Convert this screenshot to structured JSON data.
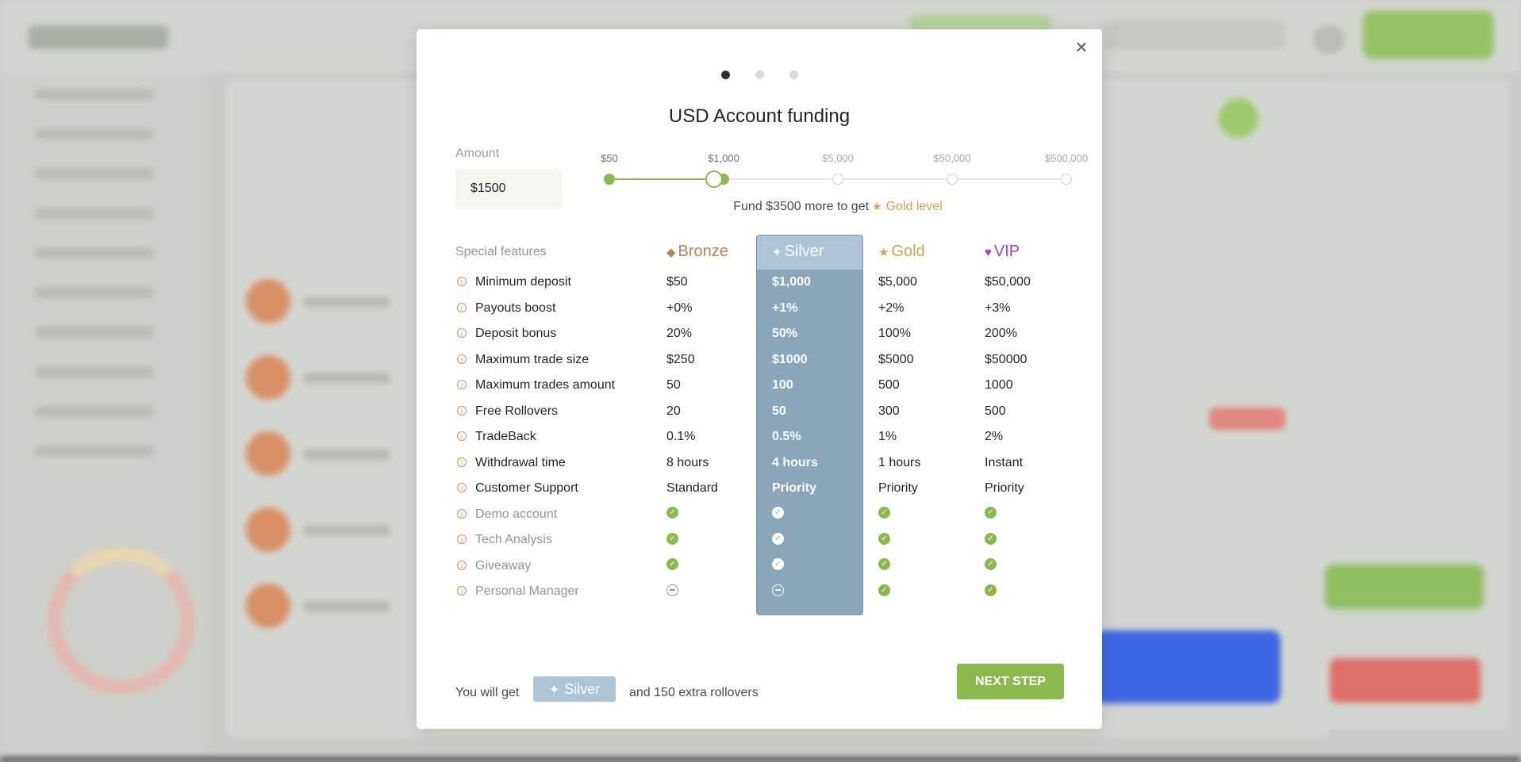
{
  "modal": {
    "title": "USD Account funding",
    "close_symbol": "×",
    "steps": 3,
    "amount_label": "Amount",
    "amount_value": "$1500",
    "slider": {
      "ticks": [
        "$50",
        "$1,000",
        "$5,000",
        "$50,000",
        "$500,000"
      ],
      "reached_count": 2,
      "position": 0.23
    },
    "fund_note": {
      "text": "Fund $3500 more to get",
      "level": "Gold level"
    },
    "table": {
      "feature_header": "Special features",
      "columns": [
        {
          "name": "Bronze",
          "icon": "diamond-icon",
          "glyph": "◆",
          "color": "#c07f58"
        },
        {
          "name": "Silver",
          "icon": "sparkle-icon",
          "glyph": "✦",
          "color": "#ffffff"
        },
        {
          "name": "Gold",
          "icon": "star-icon",
          "glyph": "★",
          "color": "#d0a352"
        },
        {
          "name": "VIP",
          "icon": "heart-icon",
          "glyph": "♥",
          "color": "#a13ed6"
        }
      ],
      "highlighted_column": 1,
      "rows": [
        {
          "feature": "Minimum deposit",
          "values": [
            "$50",
            "$1,000",
            "$5,000",
            "$50,000"
          ]
        },
        {
          "feature": "Payouts boost",
          "values": [
            "+0%",
            "+1%",
            "+2%",
            "+3%"
          ]
        },
        {
          "feature": "Deposit bonus",
          "values": [
            "20%",
            "50%",
            "100%",
            "200%"
          ]
        },
        {
          "feature": "Maximum trade size",
          "values": [
            "$250",
            "$1000",
            "$5000",
            "$50000"
          ]
        },
        {
          "feature": "Maximum trades amount",
          "values": [
            "50",
            "100",
            "500",
            "1000"
          ]
        },
        {
          "feature": "Free Rollovers",
          "values": [
            "20",
            "50",
            "300",
            "500"
          ]
        },
        {
          "feature": "TradeBack",
          "values": [
            "0.1%",
            "0.5%",
            "1%",
            "2%"
          ]
        },
        {
          "feature": "Withdrawal time",
          "values": [
            "8 hours",
            "4 hours",
            "1 hours",
            "Instant"
          ]
        },
        {
          "feature": "Customer Support",
          "values": [
            "Standard",
            "Priority",
            "Priority",
            "Priority"
          ]
        },
        {
          "feature": "Demo account",
          "muted": true,
          "flags": [
            true,
            true,
            true,
            true
          ]
        },
        {
          "feature": "Tech Analysis",
          "muted": true,
          "flags": [
            true,
            true,
            true,
            true
          ]
        },
        {
          "feature": "Giveaway",
          "muted": true,
          "flags": [
            true,
            true,
            true,
            true
          ]
        },
        {
          "feature": "Personal Manager",
          "muted": true,
          "flags": [
            false,
            false,
            true,
            true
          ]
        }
      ]
    },
    "footer": {
      "you_will_get": "You will get",
      "level": "Silver",
      "extra": "and 150 extra rollovers",
      "next_button": "NEXT STEP"
    }
  },
  "colors": {
    "accent_green": "#8ab94c",
    "silver_column": "#89a6ba",
    "gold": "#d6a24a"
  }
}
